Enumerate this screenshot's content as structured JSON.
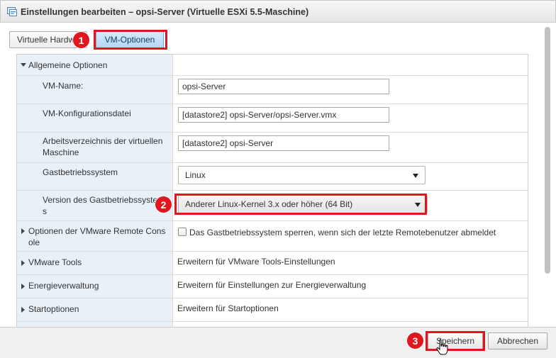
{
  "window": {
    "title": "Einstellungen bearbeiten – opsi-Server (Virtuelle ESXi 5.5-Maschine)",
    "icon": "vm-settings-icon"
  },
  "tabs": [
    {
      "label": "Virtuelle Hardware",
      "active": false
    },
    {
      "label": "VM-Optionen",
      "active": true
    }
  ],
  "callouts": [
    "1",
    "2",
    "3"
  ],
  "section": {
    "label": "Allgemeine Optionen",
    "expanded": true
  },
  "fields": {
    "vm_name": {
      "label": "VM-Name:",
      "value": "opsi-Server"
    },
    "config_file": {
      "label": "VM-Konfigurationsdatei",
      "value": "[datastore2] opsi-Server/opsi-Server.vmx"
    },
    "working_dir": {
      "label_line1": "Arbeitsverzeichnis der virtuellen",
      "label_line2": "Maschine",
      "value": "[datastore2] opsi-Server"
    },
    "guest_os": {
      "label": "Gastbetriebssystem",
      "value": "Linux"
    },
    "guest_os_version": {
      "label_line1": "Version des Gastbetriebssystem",
      "label_line2": "s",
      "value": "Anderer Linux-Kernel 3.x oder höher (64 Bit)"
    }
  },
  "collapsed_sections": {
    "remote_console": {
      "label_line1": "Optionen der VMware Remote Cons",
      "label_line2": "ole",
      "checkbox_label": "Das Gastbetriebssystem sperren, wenn sich der letzte Remotebenutzer abmeldet",
      "checked": false
    },
    "vmware_tools": {
      "label": "VMware Tools",
      "value": "Erweitern für VMware Tools-Einstellungen"
    },
    "power": {
      "label": "Energieverwaltung",
      "value": "Erweitern für Einstellungen zur Energieverwaltung"
    },
    "boot": {
      "label": "Startoptionen",
      "value": "Erweitern für Startoptionen"
    }
  },
  "footer": {
    "save_label": "Speichern",
    "cancel_label": "Abbrechen"
  },
  "colors": {
    "highlight": "#e0161f",
    "label_bg": "#e8f1f8",
    "active_tab": "#b5d6f3"
  }
}
